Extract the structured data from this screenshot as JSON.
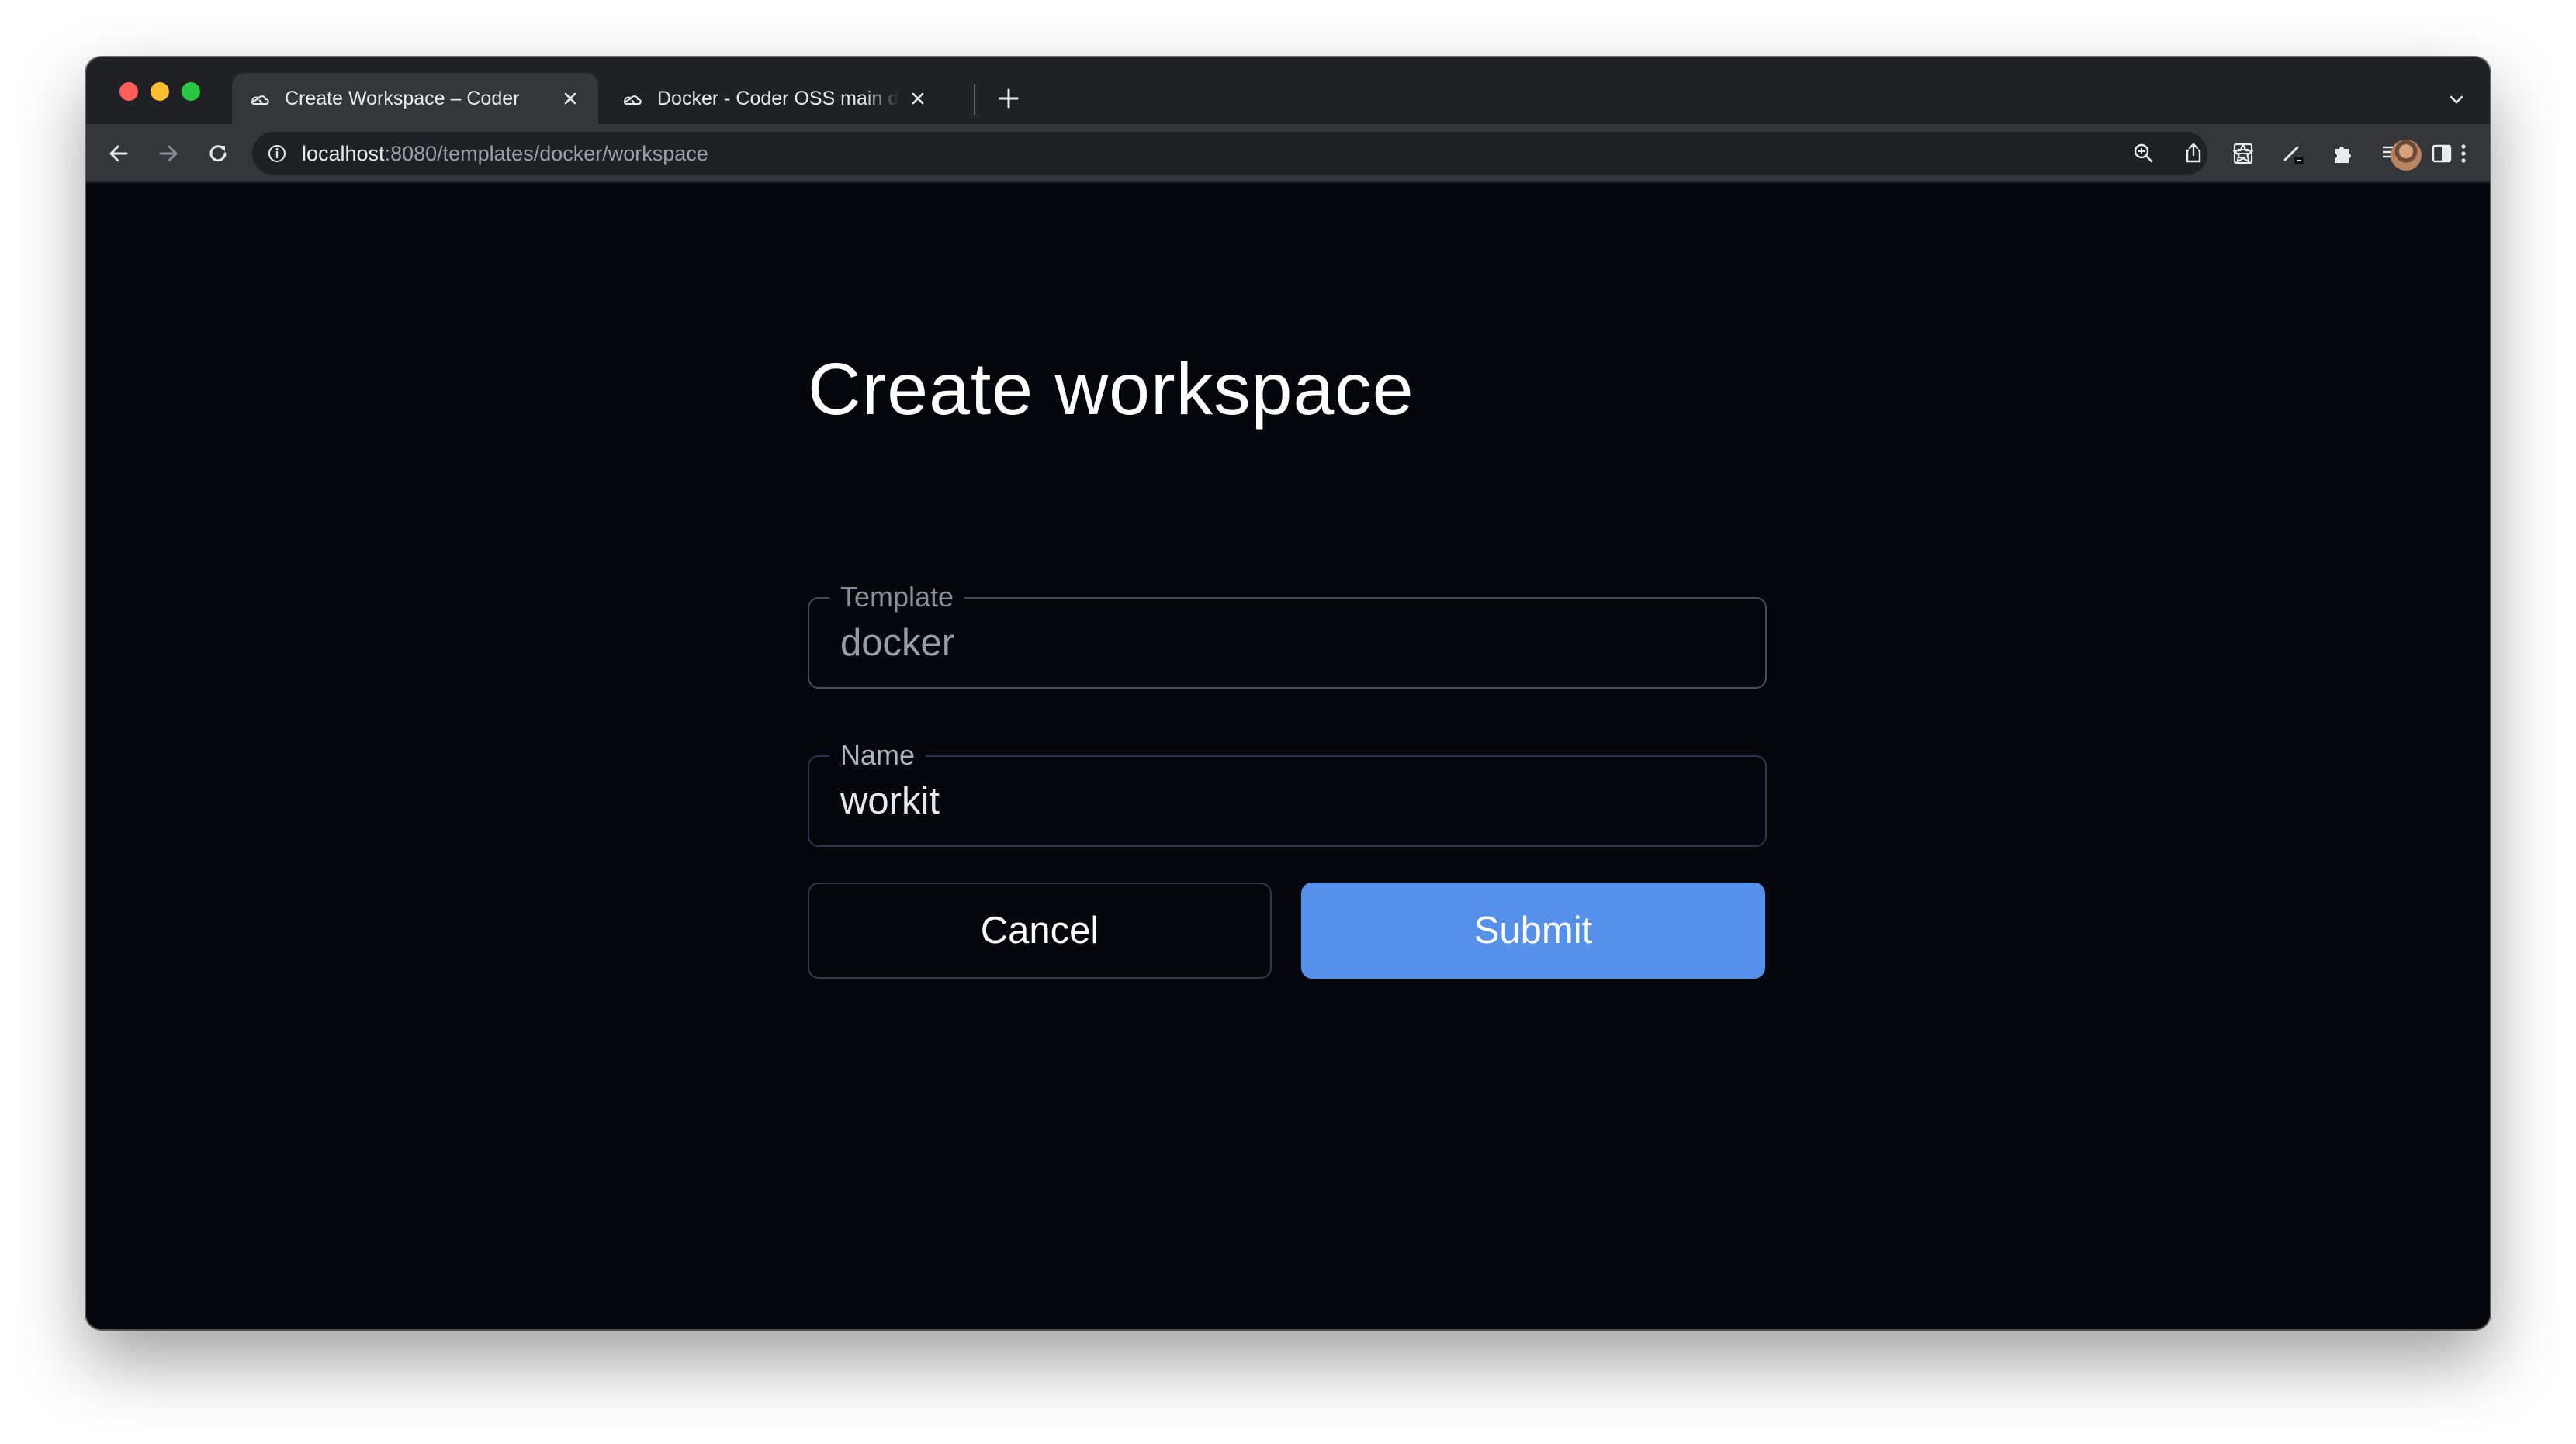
{
  "browser": {
    "tabs": [
      {
        "title": "Create Workspace – Coder",
        "active": true
      },
      {
        "title": "Docker - Coder OSS main docs",
        "active": false
      }
    ],
    "url": {
      "host": "localhost",
      "rest": ":8080/templates/docker/workspace"
    }
  },
  "page": {
    "title": "Create workspace",
    "fields": {
      "template": {
        "label": "Template",
        "value": "docker"
      },
      "name": {
        "label": "Name",
        "value": "workit"
      }
    },
    "buttons": {
      "cancel": "Cancel",
      "submit": "Submit"
    }
  },
  "colors": {
    "page_background": "#05070d",
    "accent": "#5591ea",
    "titlebar": "#202124",
    "toolbar": "#35363a"
  }
}
